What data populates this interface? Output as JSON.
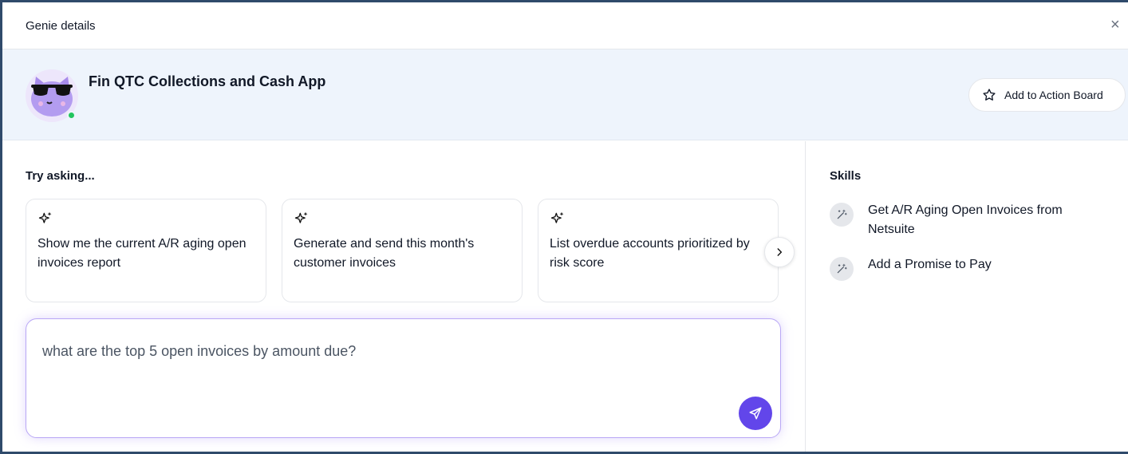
{
  "window": {
    "title": "Genie details",
    "close_label": "×"
  },
  "agent": {
    "name": "Fin QTC Collections and Cash App",
    "status_color": "#22c55e"
  },
  "actions": {
    "add_to_board_label": "Add to Action Board"
  },
  "suggestions": {
    "title": "Try asking...",
    "items": [
      {
        "text": "Show me the current A/R aging open invoices report"
      },
      {
        "text": "Generate and send this month's customer invoices"
      },
      {
        "text": "List overdue accounts prioritized by risk score"
      }
    ]
  },
  "prompt": {
    "value": "what are the top 5 open invoices by amount due?"
  },
  "skills": {
    "title": "Skills",
    "items": [
      {
        "name": "Get A/R Aging Open Invoices from Netsuite",
        "icon": "magic-wand-icon"
      },
      {
        "name": "Add a Promise to Pay",
        "icon": "magic-wand-icon"
      }
    ]
  },
  "colors": {
    "accent": "#6246ea",
    "header_bg": "#eef4fc"
  }
}
